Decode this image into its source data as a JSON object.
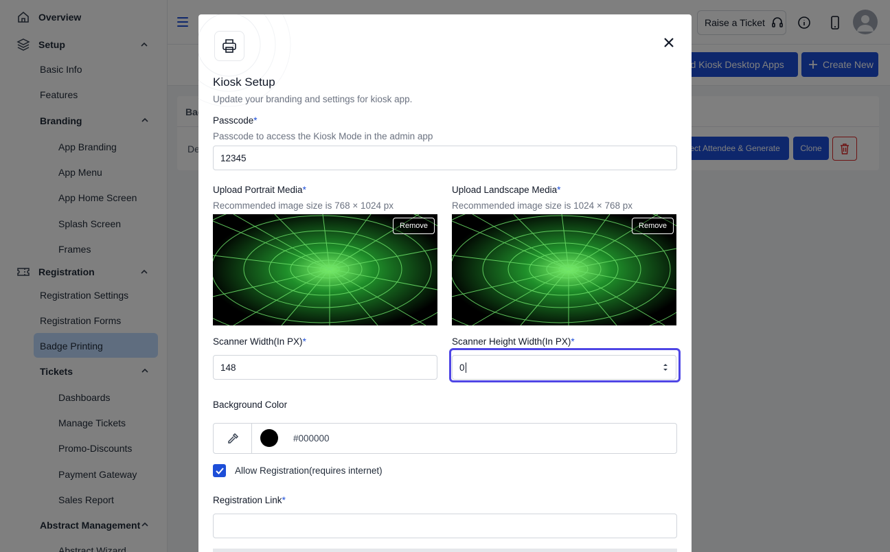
{
  "sidebar": {
    "overview": "Overview",
    "setup": "Setup",
    "basic_info": "Basic Info",
    "features": "Features",
    "branding": "Branding",
    "app_branding": "App Branding",
    "app_menu": "App Menu",
    "app_home_screen": "App Home Screen",
    "splash_screen": "Splash Screen",
    "frames": "Frames",
    "registration": "Registration",
    "registration_settings": "Registration Settings",
    "registration_forms": "Registration Forms",
    "badge_printing": "Badge Printing",
    "tickets": "Tickets",
    "dashboards": "Dashboards",
    "manage_tickets": "Manage Tickets",
    "promo_discounts": "Promo-Discounts",
    "payment_gateway": "Payment Gateway",
    "sales_report": "Sales Report",
    "abstract_management": "Abstract Management",
    "abstract_wizard": "Abstract Wizard"
  },
  "topbar": {
    "raise_ticket": "Raise a Ticket"
  },
  "page": {
    "download_button": "oad Kiosk Desktop Apps",
    "create_button": "Create New",
    "table_header_partial": "Bac",
    "row_partial": "De",
    "select_attendee_button": "elect Attendee & Generate",
    "clone_button": "Clone"
  },
  "modal": {
    "title": "Kiosk Setup",
    "subtitle": "Update your branding and settings for kiosk app.",
    "passcode_label": "Passcode",
    "passcode_hint": "Passcode to access the Kiosk Mode in the admin app",
    "passcode_value": "12345",
    "portrait_label": "Upload Portrait Media",
    "portrait_hint": "Recommended image size is 768 × 1024 px",
    "landscape_label": "Upload Landscape Media",
    "landscape_hint": "Recommended image size is 1024 × 768 px",
    "remove_label": "Remove",
    "scanner_width_label": "Scanner Width(In PX)",
    "scanner_width_value": "148",
    "scanner_height_label": "Scanner Height Width(In PX)",
    "scanner_height_value": "0",
    "bg_color_label": "Background Color",
    "bg_color_value": "#000000",
    "allow_registration_label": "Allow Registration(requires internet)",
    "allow_registration_checked": true,
    "registration_link_label": "Registration Link",
    "registration_link_value": "",
    "required_mark": "*"
  },
  "colors": {
    "accent": "#1d4ed8",
    "active_bg": "#bfdbfe",
    "swatch": "#000000",
    "media_grid": "#4ade80"
  }
}
